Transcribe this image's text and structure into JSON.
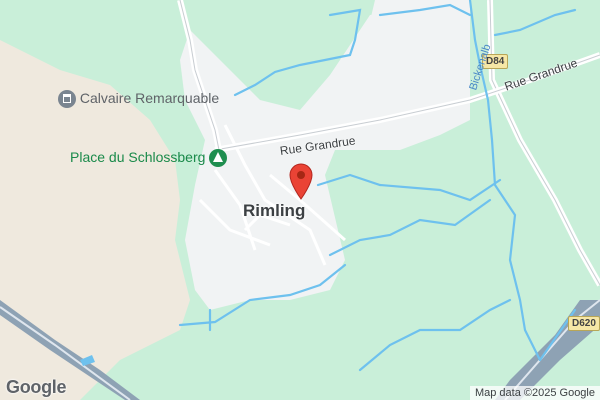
{
  "map": {
    "town": "Rimling",
    "pois": {
      "calvaire": {
        "label": "Calvaire Remarquable",
        "icon": "monument-icon"
      },
      "place": {
        "label": "Place du Schlossberg",
        "icon": "park-icon"
      }
    },
    "roads": {
      "grandrue_west": "Rue Grandrue",
      "grandrue_east": "Rue Grandrue",
      "shield_d84": "D84",
      "shield_d620": "D620"
    },
    "stream": "Bickenalb",
    "branding": "Google",
    "attribution": "Map data ©2025 Google",
    "marker": "location-pin-icon",
    "colors": {
      "park": "#c9efd9",
      "urban": "#f1f3f4",
      "farmland": "#efe9de",
      "water": "#6ec1ee",
      "highway": "#8ea2b4",
      "pin": "#ea4335"
    }
  }
}
